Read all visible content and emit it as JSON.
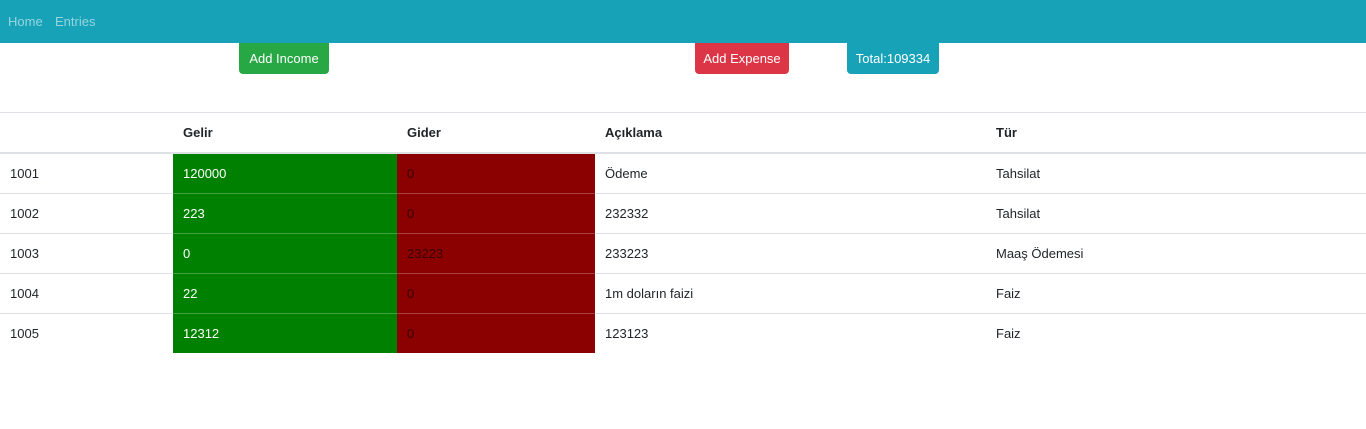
{
  "nav": {
    "items": [
      {
        "label": "Home"
      },
      {
        "label": "Entries"
      }
    ]
  },
  "actions": {
    "add_income_label": "Add Income",
    "add_expense_label": "Add Expense",
    "total_label": "Total:109334"
  },
  "colors": {
    "navbar": "#17a2b8",
    "income_button": "#28a745",
    "expense_button": "#dc3545",
    "total_button": "#17a2b8",
    "income_cell": "#008000",
    "expense_cell": "#8b0000"
  },
  "table": {
    "headers": [
      "",
      "Gelir",
      "Gider",
      "Açıklama",
      "Tür"
    ],
    "rows": [
      {
        "id": "1001",
        "gelir": "120000",
        "gider": "0",
        "aciklama": "Ödeme",
        "tur": "Tahsilat"
      },
      {
        "id": "1002",
        "gelir": "223",
        "gider": "0",
        "aciklama": "232332",
        "tur": "Tahsilat"
      },
      {
        "id": "1003",
        "gelir": "0",
        "gider": "23223",
        "aciklama": "233223",
        "tur": "Maaş Ödemesi"
      },
      {
        "id": "1004",
        "gelir": "22",
        "gider": "0",
        "aciklama": "1m doların faizi",
        "tur": "Faiz"
      },
      {
        "id": "1005",
        "gelir": "12312",
        "gider": "0",
        "aciklama": "123123",
        "tur": "Faiz"
      }
    ]
  }
}
